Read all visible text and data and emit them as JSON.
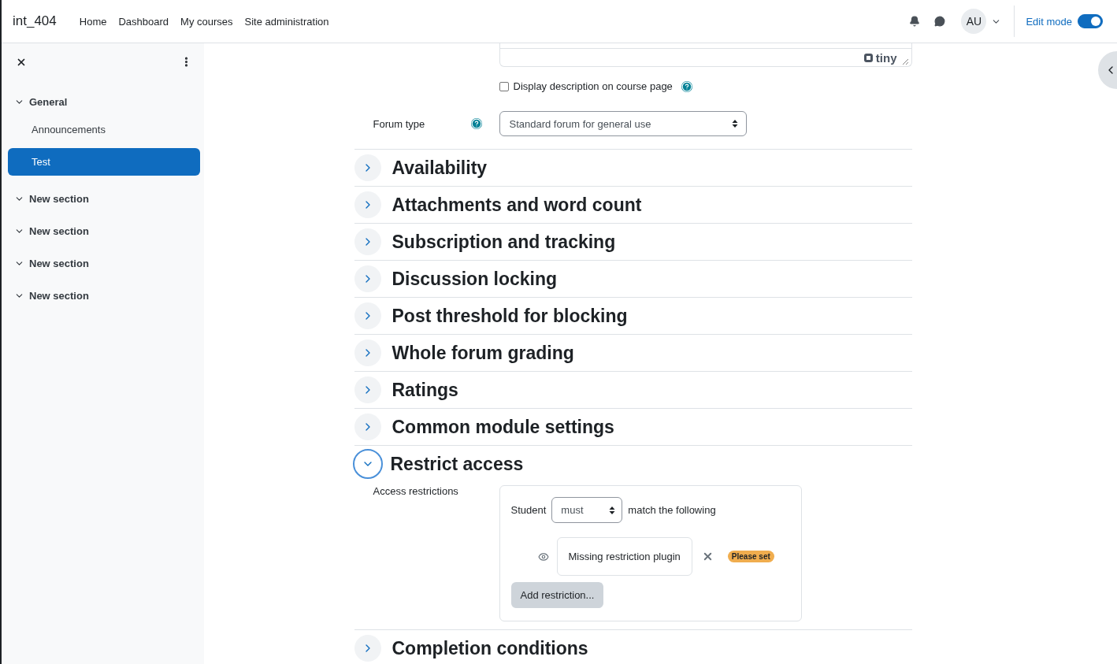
{
  "navbar": {
    "site_name": "int_404",
    "links": [
      "Home",
      "Dashboard",
      "My courses",
      "Site administration"
    ],
    "avatar": "AU",
    "edit_mode": {
      "label": "Edit mode",
      "on": true
    }
  },
  "sidebar": {
    "sections": [
      {
        "label": "General",
        "expanded": true,
        "children": [
          {
            "label": "Announcements",
            "selected": false
          },
          {
            "label": "Test",
            "selected": true
          }
        ]
      },
      {
        "label": "New section",
        "expanded": true
      },
      {
        "label": "New section",
        "expanded": true
      },
      {
        "label": "New section",
        "expanded": true
      },
      {
        "label": "New section",
        "expanded": true
      }
    ]
  },
  "editor": {
    "brand": "tiny"
  },
  "display_description": {
    "label": "Display description on course page",
    "checked": false
  },
  "forum_type": {
    "label": "Forum type",
    "value": "Standard forum for general use"
  },
  "sections": [
    {
      "title": "Availability",
      "expanded": false
    },
    {
      "title": "Attachments and word count",
      "expanded": false
    },
    {
      "title": "Subscription and tracking",
      "expanded": false
    },
    {
      "title": "Discussion locking",
      "expanded": false
    },
    {
      "title": "Post threshold for blocking",
      "expanded": false
    },
    {
      "title": "Whole forum grading",
      "expanded": false
    },
    {
      "title": "Ratings",
      "expanded": false
    },
    {
      "title": "Common module settings",
      "expanded": false
    },
    {
      "title": "Restrict access",
      "expanded": true,
      "kind": "restrict"
    },
    {
      "title": "Completion conditions",
      "expanded": false
    }
  ],
  "restrict_access": {
    "label": "Access restrictions",
    "prefix": "Student",
    "match": "must",
    "suffix": "match the following",
    "condition": "Missing restriction plugin",
    "badge": "Please set",
    "add_button": "Add restriction..."
  }
}
